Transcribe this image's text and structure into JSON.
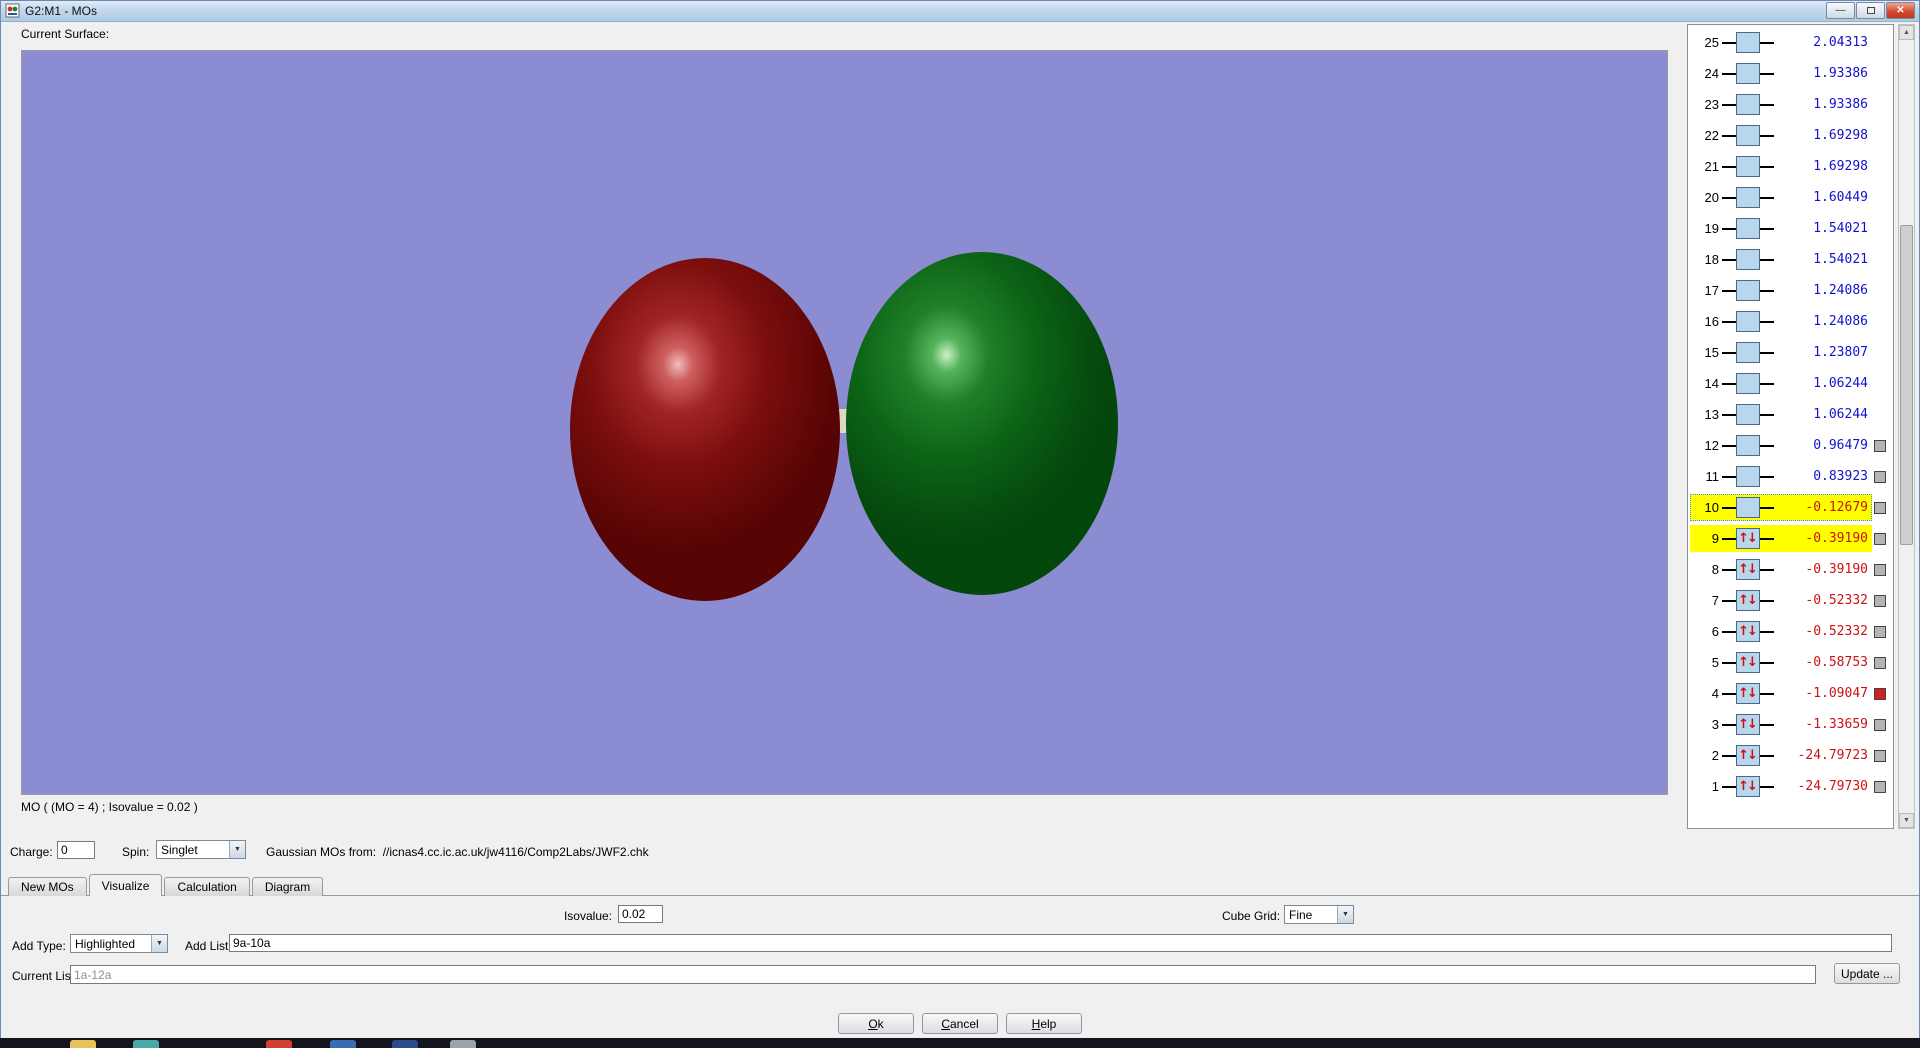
{
  "window": {
    "title": "G2:M1 - MOs"
  },
  "surface": {
    "label": "Current Surface:",
    "caption": "MO ( (MO = 4) ; Isovalue = 0.02 )",
    "background_color": "#8c8cd2",
    "lobes": [
      {
        "name": "negative-phase-lobe",
        "color": "#7c0e0e"
      },
      {
        "name": "positive-phase-lobe",
        "color": "#0c6416"
      }
    ]
  },
  "mo_list": {
    "rows": [
      {
        "index": 25,
        "energy": "2.04313",
        "occupied": false,
        "highlighted": false,
        "selected": false,
        "checkbox": null
      },
      {
        "index": 24,
        "energy": "1.93386",
        "occupied": false,
        "highlighted": false,
        "selected": false,
        "checkbox": null
      },
      {
        "index": 23,
        "energy": "1.93386",
        "occupied": false,
        "highlighted": false,
        "selected": false,
        "checkbox": null
      },
      {
        "index": 22,
        "energy": "1.69298",
        "occupied": false,
        "highlighted": false,
        "selected": false,
        "checkbox": null
      },
      {
        "index": 21,
        "energy": "1.69298",
        "occupied": false,
        "highlighted": false,
        "selected": false,
        "checkbox": null
      },
      {
        "index": 20,
        "energy": "1.60449",
        "occupied": false,
        "highlighted": false,
        "selected": false,
        "checkbox": null
      },
      {
        "index": 19,
        "energy": "1.54021",
        "occupied": false,
        "highlighted": false,
        "selected": false,
        "checkbox": null
      },
      {
        "index": 18,
        "energy": "1.54021",
        "occupied": false,
        "highlighted": false,
        "selected": false,
        "checkbox": null
      },
      {
        "index": 17,
        "energy": "1.24086",
        "occupied": false,
        "highlighted": false,
        "selected": false,
        "checkbox": null
      },
      {
        "index": 16,
        "energy": "1.24086",
        "occupied": false,
        "highlighted": false,
        "selected": false,
        "checkbox": null
      },
      {
        "index": 15,
        "energy": "1.23807",
        "occupied": false,
        "highlighted": false,
        "selected": false,
        "checkbox": null
      },
      {
        "index": 14,
        "energy": "1.06244",
        "occupied": false,
        "highlighted": false,
        "selected": false,
        "checkbox": null
      },
      {
        "index": 13,
        "energy": "1.06244",
        "occupied": false,
        "highlighted": false,
        "selected": false,
        "checkbox": null
      },
      {
        "index": 12,
        "energy": "0.96479",
        "occupied": false,
        "highlighted": false,
        "selected": false,
        "checkbox": "gray"
      },
      {
        "index": 11,
        "energy": "0.83923",
        "occupied": false,
        "highlighted": false,
        "selected": false,
        "checkbox": "gray"
      },
      {
        "index": 10,
        "energy": "-0.12679",
        "occupied": false,
        "highlighted": true,
        "selected": true,
        "checkbox": "gray"
      },
      {
        "index": 9,
        "energy": "-0.39190",
        "occupied": true,
        "highlighted": true,
        "selected": false,
        "checkbox": "gray"
      },
      {
        "index": 8,
        "energy": "-0.39190",
        "occupied": true,
        "highlighted": false,
        "selected": false,
        "checkbox": "gray"
      },
      {
        "index": 7,
        "energy": "-0.52332",
        "occupied": true,
        "highlighted": false,
        "selected": false,
        "checkbox": "gray"
      },
      {
        "index": 6,
        "energy": "-0.52332",
        "occupied": true,
        "highlighted": false,
        "selected": false,
        "checkbox": "gray"
      },
      {
        "index": 5,
        "energy": "-0.58753",
        "occupied": true,
        "highlighted": false,
        "selected": false,
        "checkbox": "gray"
      },
      {
        "index": 4,
        "energy": "-1.09047",
        "occupied": true,
        "highlighted": false,
        "selected": false,
        "checkbox": "red"
      },
      {
        "index": 3,
        "energy": "-1.33659",
        "occupied": true,
        "highlighted": false,
        "selected": false,
        "checkbox": "gray"
      },
      {
        "index": 2,
        "energy": "-24.79723",
        "occupied": true,
        "highlighted": false,
        "selected": false,
        "checkbox": "gray"
      },
      {
        "index": 1,
        "energy": "-24.79730",
        "occupied": true,
        "highlighted": false,
        "selected": false,
        "checkbox": "gray"
      }
    ],
    "energy_color_positive": "#1212cc",
    "energy_color_negative": "#cc1212",
    "highlight_color": "#ffff00"
  },
  "controls": {
    "charge_label": "Charge:",
    "charge_value": "0",
    "spin_label": "Spin:",
    "spin_value": "Singlet",
    "source_text": "Gaussian MOs from:  //icnas4.cc.ic.ac.uk/jw4116/Comp2Labs/JWF2.chk"
  },
  "tabs": [
    {
      "label": "New MOs",
      "active": false
    },
    {
      "label": "Visualize",
      "active": true
    },
    {
      "label": "Calculation",
      "active": false
    },
    {
      "label": "Diagram",
      "active": false
    }
  ],
  "visualize_tab": {
    "isovalue_label": "Isovalue:",
    "isovalue_value": "0.02",
    "cube_grid_label": "Cube Grid:",
    "cube_grid_value": "Fine",
    "add_type_label": "Add Type:",
    "add_type_value": "Highlighted",
    "add_list_label": "Add List:",
    "add_list_value": "9a-10a",
    "current_list_label": "Current List:",
    "current_list_value": "1a-12a",
    "update_button": "Update ..."
  },
  "footer_buttons": [
    {
      "label": "Ok"
    },
    {
      "label": "Cancel"
    },
    {
      "label": "Help"
    }
  ],
  "titlebar_buttons": {
    "minimize": "—",
    "close": "✕"
  },
  "taskbar": {
    "icons": [
      {
        "name": "folder-icon",
        "color": "#e8c25a"
      },
      {
        "name": "app-icon-teal",
        "color": "#4aa8a8"
      },
      {
        "name": "browser-icon-red",
        "color": "#d04030"
      },
      {
        "name": "app-icon-blue",
        "color": "#3a6cb4"
      },
      {
        "name": "app-icon-darkblue",
        "color": "#2a4a8a"
      },
      {
        "name": "app-icon-gray",
        "color": "#9aa2ac"
      }
    ]
  }
}
